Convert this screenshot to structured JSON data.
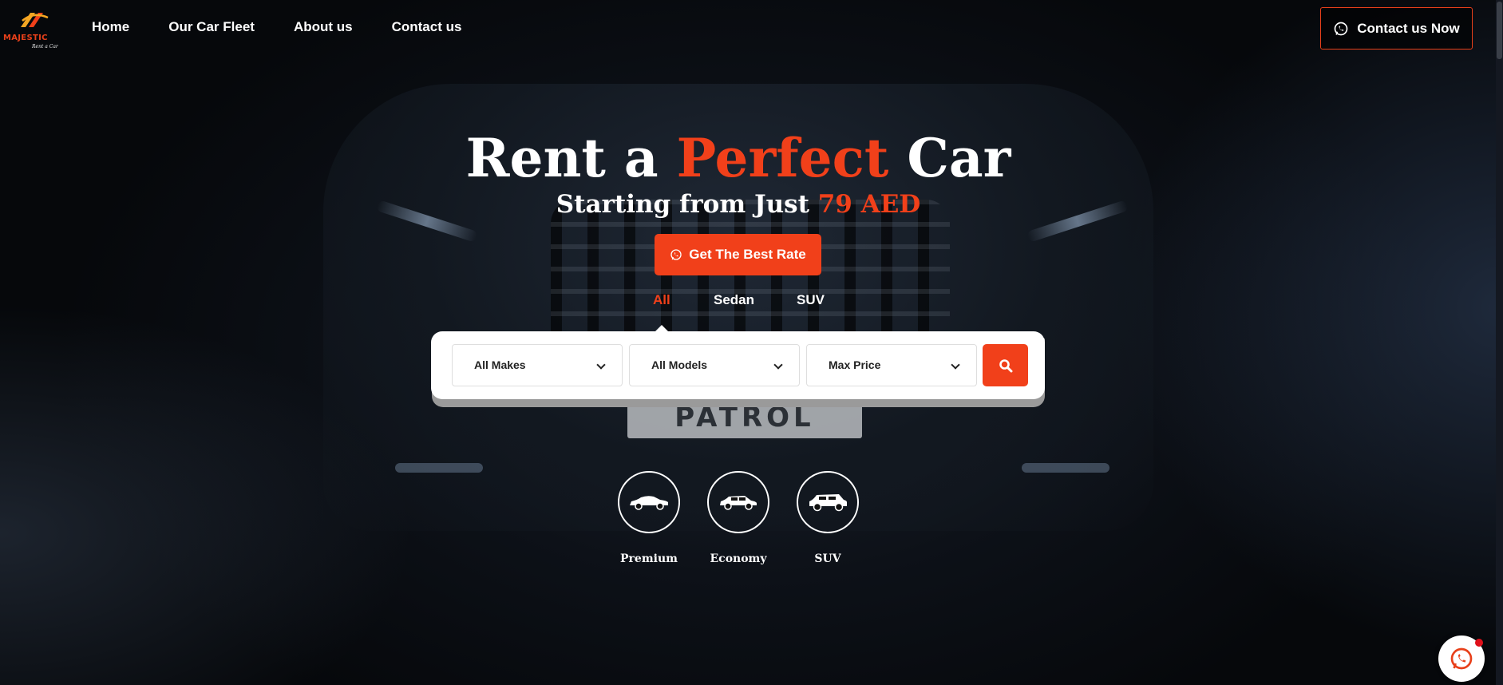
{
  "brand": {
    "name": "MAJESTIC",
    "tagline": "Rent a Car"
  },
  "nav": {
    "items": [
      {
        "label": "Home"
      },
      {
        "label": "Our Car Fleet"
      },
      {
        "label": "About us"
      },
      {
        "label": "Contact us"
      }
    ]
  },
  "header_cta": {
    "label": "Contact us Now",
    "icon": "whatsapp-icon"
  },
  "hero": {
    "title_part1": "Rent a ",
    "title_accent": "Perfect",
    "title_part2": " Car",
    "subtitle_part1": "Starting from Just ",
    "subtitle_accent": "79 AED",
    "cta_label": "Get The Best Rate",
    "cta_icon": "whatsapp-icon",
    "background_plate_text": "PATROL"
  },
  "tabs": [
    {
      "label": "All",
      "active": true
    },
    {
      "label": "Sedan",
      "active": false
    },
    {
      "label": "SUV",
      "active": false
    }
  ],
  "search": {
    "makes": "All Makes",
    "models": "All Models",
    "price": "Max Price",
    "button_icon": "search-icon"
  },
  "categories": [
    {
      "label": "Premium",
      "icon": "sedan-car-icon"
    },
    {
      "label": "Economy",
      "icon": "hatchback-car-icon"
    },
    {
      "label": "SUV",
      "icon": "suv-car-icon"
    }
  ],
  "floating_chat": {
    "icon": "whatsapp-icon",
    "notification": true
  },
  "colors": {
    "accent": "#f1401a",
    "background": "#07090d",
    "text": "#ffffff"
  }
}
